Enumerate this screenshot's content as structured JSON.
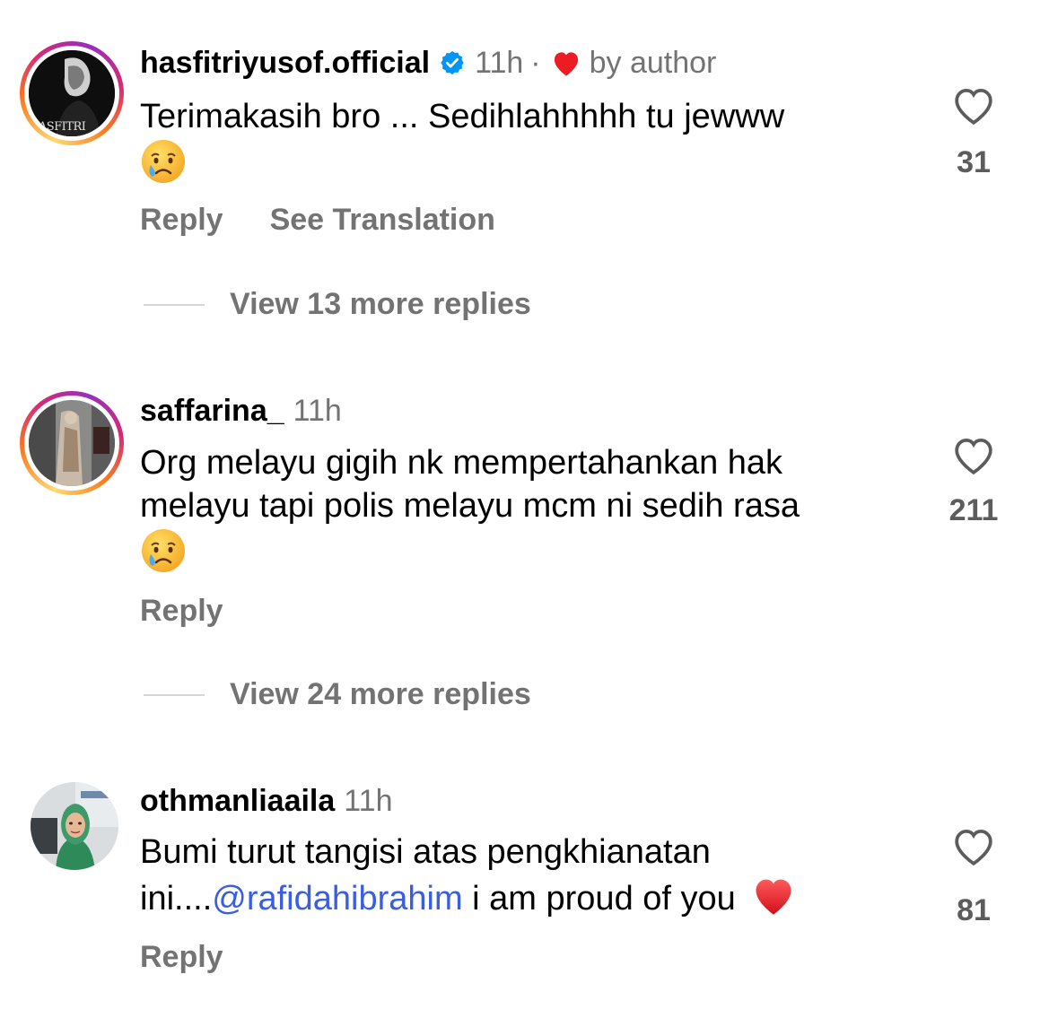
{
  "comments": [
    {
      "username": "hasfitriyusof.official",
      "time": "11h",
      "dot": "·",
      "by_author": "by author",
      "text": "Terimakasih bro ... Sedihlahhhhh  tu jewww",
      "likes": "31",
      "reply_label": "Reply",
      "translate_label": "See Translation",
      "view_replies": "View 13 more replies",
      "avatar_text": "HASFITRI"
    },
    {
      "username": "saffarina_",
      "time": "11h",
      "text_line1": "Org melayu gigih nk mempertahankan hak",
      "text_line2": "melayu tapi polis melayu mcm ni sedih rasa",
      "likes": "211",
      "reply_label": "Reply",
      "view_replies": "View 24 more replies"
    },
    {
      "username": "othmanliaaila",
      "time": "11h",
      "text_line1": "Bumi turut tangisi atas pengkhianatan",
      "text_prefix": "ini....",
      "mention": "@rafidahibrahim",
      "text_suffix": " i am proud of you",
      "likes": "81",
      "reply_label": "Reply"
    }
  ],
  "icons": {
    "verified": "verified-badge-icon",
    "author_heart": "red-heart-icon",
    "like": "heart-outline-icon",
    "crying_emoji": "crying-face-emoji",
    "red_heart_emoji": "red-heart-emoji"
  },
  "colors": {
    "secondary_text": "#737373",
    "mention": "#3a5ee0",
    "verified": "#0095f6",
    "heart": "#ed1c24"
  }
}
